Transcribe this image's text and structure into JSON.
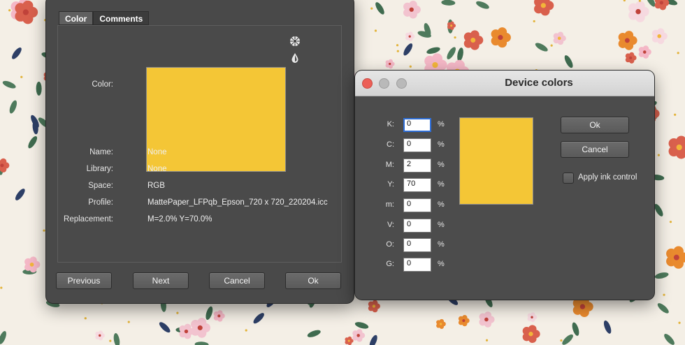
{
  "color_window": {
    "tabs": [
      "Color",
      "Comments"
    ],
    "color_label": "Color:",
    "swatch_color": "#f4c636",
    "fields": [
      {
        "label": "Name:",
        "value": "None"
      },
      {
        "label": "Library:",
        "value": "None"
      },
      {
        "label": "Space:",
        "value": "RGB"
      },
      {
        "label": "Profile:",
        "value": "MattePaper_LFPqb_Epson_720 x 720_220204.icc"
      },
      {
        "label": "Replacement:",
        "value": "M=2.0% Y=70.0%"
      }
    ],
    "icons": [
      "color-wheel-icon",
      "eyedropper-drop-icon"
    ],
    "buttons": {
      "previous": "Previous",
      "next": "Next",
      "cancel": "Cancel",
      "ok": "Ok"
    }
  },
  "device_window": {
    "title": "Device colors",
    "traffic_colors": {
      "close": "#ec5f57",
      "minimize": "#b9b9b9",
      "zoom": "#b9b9b9"
    },
    "inks": [
      {
        "label": "K:",
        "value": "0",
        "unit": "%"
      },
      {
        "label": "C:",
        "value": "0",
        "unit": "%"
      },
      {
        "label": "M:",
        "value": "2",
        "unit": "%"
      },
      {
        "label": "Y:",
        "value": "70",
        "unit": "%"
      },
      {
        "label": "m:",
        "value": "0",
        "unit": "%"
      },
      {
        "label": "V:",
        "value": "0",
        "unit": "%"
      },
      {
        "label": "O:",
        "value": "0",
        "unit": "%"
      },
      {
        "label": "G:",
        "value": "0",
        "unit": "%"
      }
    ],
    "swatch_color": "#f4c636",
    "ok_label": "Ok",
    "cancel_label": "Cancel",
    "apply_ink_label": "Apply ink control",
    "apply_ink_checked": false
  }
}
